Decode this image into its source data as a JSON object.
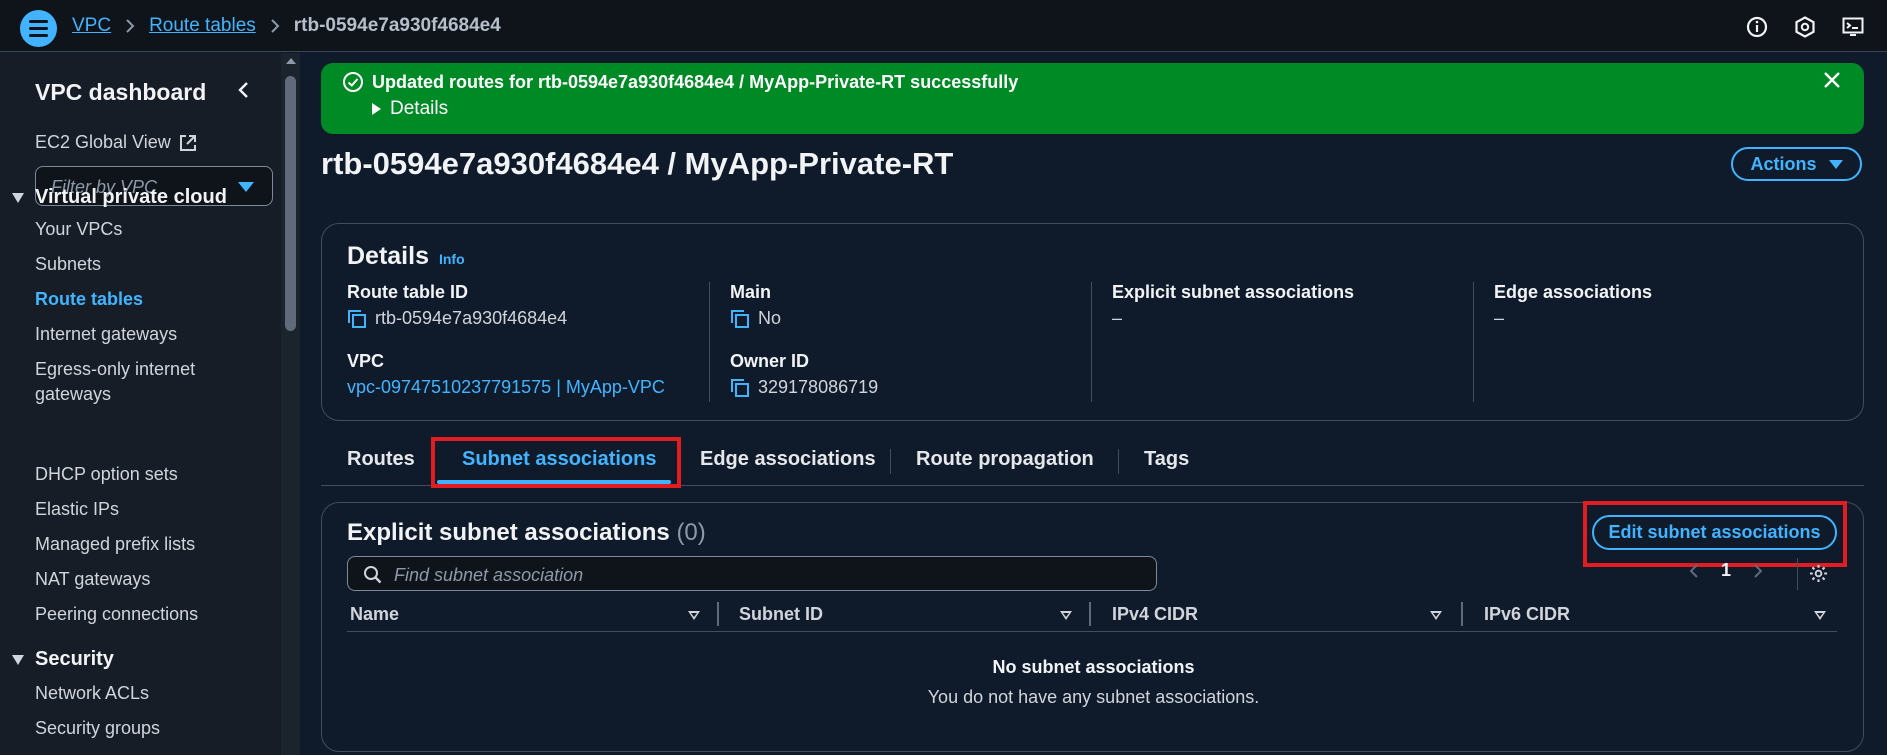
{
  "breadcrumb": {
    "items": [
      "VPC",
      "Route tables"
    ],
    "current": "rtb-0594e7a930f4684e4"
  },
  "topbar": {
    "icons": [
      "info-icon",
      "feedback-icon",
      "cloudshell-icon"
    ]
  },
  "sidebar": {
    "title": "VPC dashboard",
    "ec2_global_view": "EC2 Global View",
    "filter_placeholder": "Filter by VPC",
    "section_vpc": "Virtual private cloud",
    "items": [
      "Your VPCs",
      "Subnets",
      "Route tables",
      "Internet gateways",
      "Egress-only internet",
      "gateways",
      "DHCP option sets",
      "Elastic IPs",
      "Managed prefix lists",
      "NAT gateways",
      "Peering connections"
    ],
    "active_item": "Route tables",
    "section_security": "Security",
    "security_items": [
      "Network ACLs",
      "Security groups"
    ]
  },
  "banner": {
    "message": "Updated routes for rtb-0594e7a930f4684e4 / MyApp-Private-RT successfully",
    "details": "Details",
    "color": "#008a25"
  },
  "page": {
    "title": "rtb-0594e7a930f4684e4 / MyApp-Private-RT",
    "actions": "Actions"
  },
  "details": {
    "heading": "Details",
    "info": "Info",
    "route_table_id_label": "Route table ID",
    "route_table_id": "rtb-0594e7a930f4684e4",
    "main_label": "Main",
    "main": "No",
    "explicit_label": "Explicit subnet associations",
    "explicit": "–",
    "edge_label": "Edge associations",
    "edge": "–",
    "vpc_label": "VPC",
    "vpc": "vpc-09747510237791575 | MyApp-VPC",
    "owner_label": "Owner ID",
    "owner": "329178086719"
  },
  "tabs": [
    "Routes",
    "Subnet associations",
    "Edge associations",
    "Route propagation",
    "Tags"
  ],
  "active_tab": "Subnet associations",
  "associations": {
    "title": "Explicit subnet associations",
    "count": "(0)",
    "edit_button": "Edit subnet associations",
    "search_placeholder": "Find subnet association",
    "page": "1",
    "columns": [
      "Name",
      "Subnet ID",
      "IPv4 CIDR",
      "IPv6 CIDR"
    ],
    "empty_title": "No subnet associations",
    "empty_text": "You do not have any subnet associations."
  },
  "colors": {
    "accent": "#42b4ff",
    "highlight": "#e11d22",
    "success": "#008a25"
  }
}
